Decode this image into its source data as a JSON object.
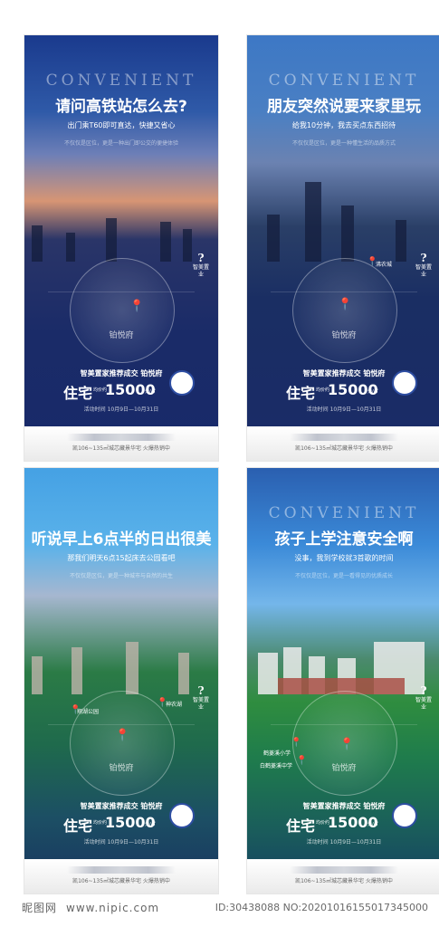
{
  "posters": [
    {
      "conv": "CONVENIENT",
      "title": "请问高铁站怎么去?",
      "sub": "出门乘T60即可直达，快捷又省心",
      "sub2": "不仅仅是区位，更是一种出门即公交的便捷体验",
      "center": "铂悦府",
      "promo": "智美置家推荐成交 铂悦府",
      "res": "住宅",
      "tag": "均价约",
      "price": "15000",
      "unit": "元/㎡",
      "date": "活动时间 10月9日—10月31日",
      "foot": "凯106~135㎡城芯藏景华宅 火爆热销中"
    },
    {
      "conv": "CONVENIENT",
      "title": "朋友突然说要来家里玩",
      "sub": "给我10分钟，我去买点东西招待",
      "sub2": "不仅仅是区位，更是一种懂生活的品质方式",
      "center": "铂悦府",
      "poi1": "沸农城",
      "promo": "智美置家推荐成交 铂悦府",
      "res": "住宅",
      "tag": "均价约",
      "price": "15000",
      "unit": "元/㎡",
      "date": "活动时间 10月9日—10月31日",
      "foot": "凯106~135㎡城芯藏景华宅 火爆热销中"
    },
    {
      "conv": "",
      "title": "听说早上6点半的日出很美",
      "sub": "那我们明天6点15起床去公园看吧",
      "sub2": "不仅仅是区位，更是一种城市与自然的共生",
      "center": "铂悦府",
      "poi1": "翔湖公园",
      "poi2": "神农湖",
      "promo": "智美置家推荐成交 铂悦府",
      "res": "住宅",
      "tag": "均价约",
      "price": "15000",
      "unit": "元/㎡",
      "date": "活动时间 10月9日—10月31日",
      "foot": "凯106~135㎡城芯藏景华宅 火爆热销中"
    },
    {
      "conv": "CONVENIENT",
      "title": "孩子上学注意安全啊",
      "sub": "没事，我到学校就3首歌的时间",
      "sub2": "不仅仅是区位，更是一看得见的优质成长",
      "center": "铂悦府",
      "poi1": "鹤菱溪小学",
      "poi2": "白鹤菱溪中学",
      "promo": "智美置家推荐成交 铂悦府",
      "res": "住宅",
      "tag": "均价约",
      "price": "15000",
      "unit": "元/㎡",
      "date": "活动时间 10月9日—10月31日",
      "foot": "凯106~135㎡城芯藏景华宅 火爆热销中"
    }
  ],
  "watermark": {
    "logo": "昵图网",
    "url": "www.nipic.com",
    "id": "ID:30438088 NO:20201016155017345000"
  }
}
